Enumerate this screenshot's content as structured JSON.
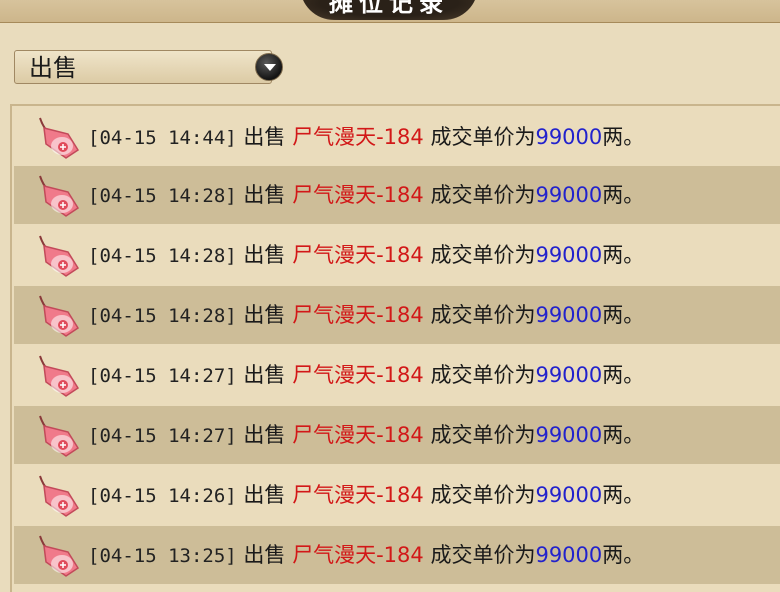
{
  "title": "摊位记录",
  "filter": {
    "selected": "出售"
  },
  "records": [
    {
      "time": "[04-15 14:44]",
      "action": "出售",
      "item": "尸气漫天-184",
      "price_label": "成交单价为",
      "price": "99000",
      "unit": "两。"
    },
    {
      "time": "[04-15 14:28]",
      "action": "出售",
      "item": "尸气漫天-184",
      "price_label": "成交单价为",
      "price": "99000",
      "unit": "两。"
    },
    {
      "time": "[04-15 14:28]",
      "action": "出售",
      "item": "尸气漫天-184",
      "price_label": "成交单价为",
      "price": "99000",
      "unit": "两。"
    },
    {
      "time": "[04-15 14:28]",
      "action": "出售",
      "item": "尸气漫天-184",
      "price_label": "成交单价为",
      "price": "99000",
      "unit": "两。"
    },
    {
      "time": "[04-15 14:27]",
      "action": "出售",
      "item": "尸气漫天-184",
      "price_label": "成交单价为",
      "price": "99000",
      "unit": "两。"
    },
    {
      "time": "[04-15 14:27]",
      "action": "出售",
      "item": "尸气漫天-184",
      "price_label": "成交单价为",
      "price": "99000",
      "unit": "两。"
    },
    {
      "time": "[04-15 14:26]",
      "action": "出售",
      "item": "尸气漫天-184",
      "price_label": "成交单价为",
      "price": "99000",
      "unit": "两。"
    },
    {
      "time": "[04-15 13:25]",
      "action": "出售",
      "item": "尸气漫天-184",
      "price_label": "成交单价为",
      "price": "99000",
      "unit": "两。"
    }
  ],
  "icons": {
    "row_icon": "pink-tag-icon",
    "dropdown": "chevron-down-icon"
  },
  "colors": {
    "item": "#d21818",
    "price": "#2222cc"
  }
}
